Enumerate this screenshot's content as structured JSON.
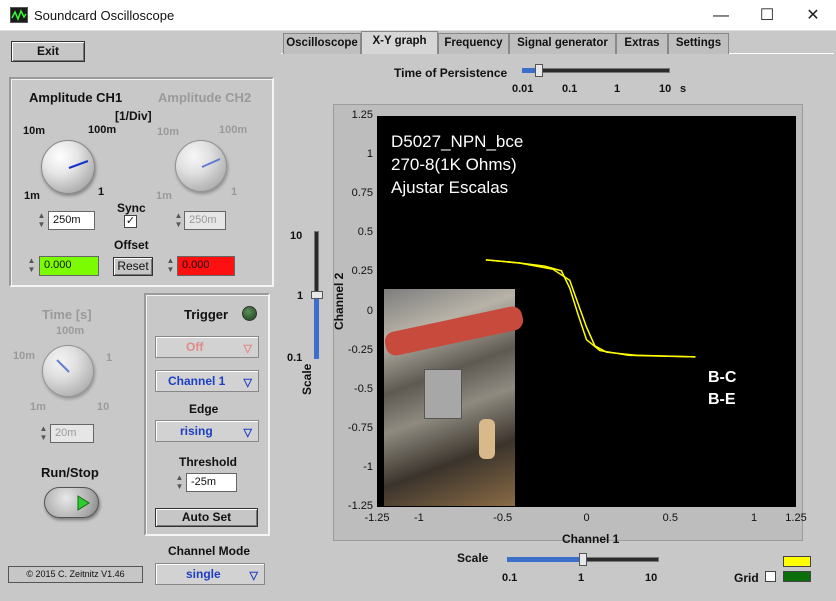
{
  "window": {
    "title": "Soundcard Oscilloscope",
    "minimize": "—",
    "maximize": "☐",
    "close": "✕"
  },
  "exit_label": "Exit",
  "ch1": {
    "title": "Amplitude CH1",
    "unit": "[1/Div]",
    "ticks": {
      "t10m": "10m",
      "t100m": "100m",
      "t1m": "1m",
      "t1": "1"
    },
    "value": "250m"
  },
  "ch2": {
    "title": "Amplitude CH2",
    "ticks": {
      "t10m": "10m",
      "t100m": "100m",
      "t1m": "1m",
      "t1": "1"
    },
    "value": "250m"
  },
  "sync_label": "Sync",
  "sync_checked": true,
  "offset": {
    "label": "Offset",
    "ch1_value": "0.000",
    "ch2_value": "0.000",
    "reset_label": "Reset",
    "ch1_color": "#7cfc00",
    "ch2_color": "#ff1010"
  },
  "time": {
    "title": "Time [s]",
    "ticks": {
      "t100m": "100m",
      "t10m": "10m",
      "t1": "1",
      "t1m": "1m",
      "t10": "10"
    },
    "value": "20m"
  },
  "run_stop_label": "Run/Stop",
  "copyright": "© 2015  C. Zeitnitz V1.46",
  "trigger": {
    "title": "Trigger",
    "mode": "Off",
    "channel": "Channel 1",
    "edge_label": "Edge",
    "edge": "rising",
    "threshold_label": "Threshold",
    "threshold": "-25m",
    "autoset_label": "Auto Set"
  },
  "channel_mode": {
    "label": "Channel Mode",
    "value": "single"
  },
  "tabs": [
    "Oscilloscope",
    "X-Y graph",
    "Frequency",
    "Signal generator",
    "Extras",
    "Settings"
  ],
  "active_tab": "X-Y graph",
  "persistence": {
    "label": "Time of Persistence",
    "ticks": [
      "0.01",
      "0.1",
      "1",
      "10"
    ],
    "unit": "s",
    "value": 0.02
  },
  "vscale": {
    "label": "Scale",
    "ticks": [
      "10",
      "1",
      "0.1"
    ],
    "value": 1
  },
  "hscale": {
    "label": "Scale",
    "ticks": [
      "0.1",
      "1",
      "10"
    ],
    "value": 1
  },
  "grid_label": "Grid",
  "trace_colors": {
    "bc": "#ffff00",
    "be": "#0b6e0b"
  },
  "xy": {
    "y_axis_label": "Channel 2",
    "x_axis_label": "Channel 1",
    "y_ticks": [
      "1.25",
      "1",
      "0.75",
      "0.5",
      "0.25",
      "0",
      "-0.25",
      "-0.5",
      "-0.75",
      "-1",
      "-1.25"
    ],
    "x_ticks": [
      "-1.25",
      "-1",
      "-0.5",
      "0",
      "0.5",
      "1",
      "1.25"
    ],
    "annotation": [
      "D5027_NPN_bce",
      "270-8(1K Ohms)",
      "Ajustar Escalas"
    ],
    "legend": [
      "B-C",
      "B-E"
    ]
  },
  "chart_data": {
    "type": "line",
    "xlabel": "Channel 1",
    "ylabel": "Channel 2",
    "xlim": [
      -1.25,
      1.25
    ],
    "ylim": [
      -1.25,
      1.25
    ],
    "grid": false,
    "series": [
      {
        "name": "B-C",
        "x": [
          -0.6,
          -0.4,
          -0.2,
          -0.1,
          -0.05,
          0.0,
          0.05,
          0.12,
          0.3,
          0.65
        ],
        "y": [
          0.33,
          0.31,
          0.27,
          0.2,
          0.05,
          -0.1,
          -0.22,
          -0.26,
          -0.28,
          -0.29
        ]
      },
      {
        "name": "B-E",
        "x": [
          -0.6,
          -0.4,
          -0.25,
          -0.15,
          -0.1,
          -0.05,
          0.0,
          0.08,
          0.25,
          0.65
        ],
        "y": [
          0.33,
          0.31,
          0.29,
          0.26,
          0.15,
          -0.02,
          -0.18,
          -0.25,
          -0.28,
          -0.29
        ]
      }
    ]
  }
}
